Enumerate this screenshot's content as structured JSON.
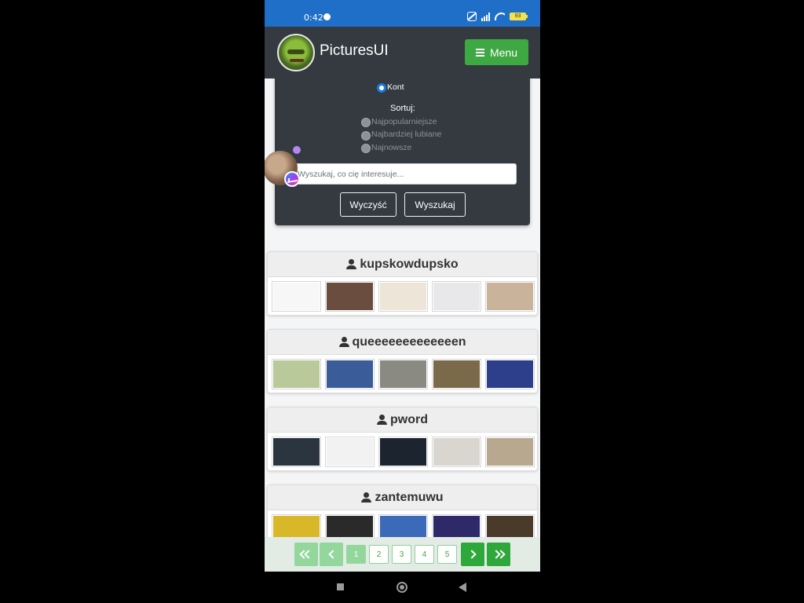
{
  "status_bar": {
    "time": "0:42",
    "battery": "93"
  },
  "navbar": {
    "brand": "PicturesUI",
    "menu_label": "Menu"
  },
  "filter": {
    "type_options": [
      {
        "label": "Kont",
        "selected": true
      }
    ],
    "sort_title": "Sortuj:",
    "sort_options": [
      {
        "label": "Najpopularniejsze",
        "selected": false
      },
      {
        "label": "Najbardziej lubiane",
        "selected": false
      },
      {
        "label": "Najnowsze",
        "selected": false
      }
    ],
    "search_placeholder": "Wyszukaj, co cię interesuje...",
    "clear_label": "Wyczyść",
    "search_label": "Wyszukaj"
  },
  "users": [
    {
      "name": "kupskowdupsko",
      "thumbs": [
        "#f7f7f7",
        "#6a4d3e",
        "#ede6d8",
        "#e8e8ea",
        "#c9b39b"
      ]
    },
    {
      "name": "queeeeeeeeeeeeen",
      "thumbs": [
        "#b9c99a",
        "#3a5d9a",
        "#8a8a82",
        "#7a6a4a",
        "#2d3f8a"
      ]
    },
    {
      "name": "pword",
      "thumbs": [
        "#2a3540",
        "#f2f2f2",
        "#1c2430",
        "#d9d6d0",
        "#b8a890"
      ]
    },
    {
      "name": "zantemuwu",
      "thumbs": [
        "#d8b828",
        "#2a2a2a",
        "#3a6ab8",
        "#2e2a6a",
        "#4a3a2a"
      ]
    }
  ],
  "pagination": {
    "pages": [
      "1",
      "2",
      "3",
      "4",
      "5"
    ],
    "current": "1"
  }
}
